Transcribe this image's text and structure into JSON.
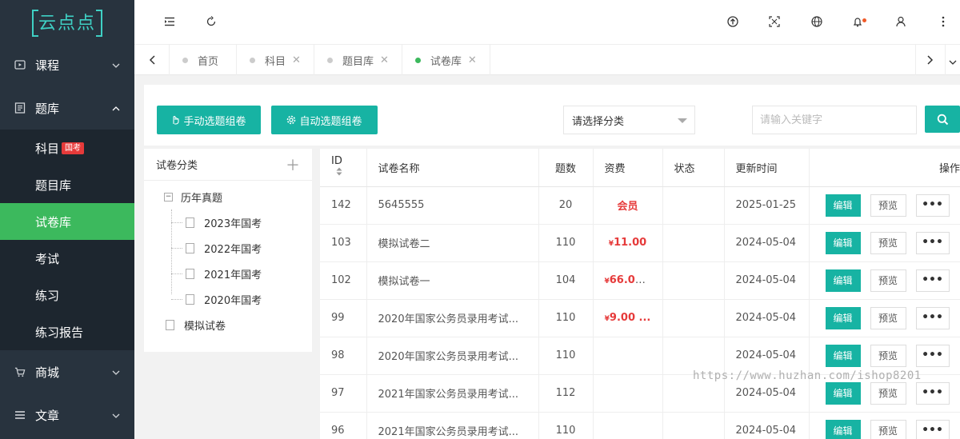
{
  "logo": {
    "text": "云点点"
  },
  "sidebar": {
    "groups": [
      {
        "label": "课程",
        "icon": "video-icon"
      },
      {
        "label": "题库",
        "icon": "book-icon"
      },
      {
        "label": "商城",
        "icon": "cart-icon"
      },
      {
        "label": "文章",
        "icon": "article-icon"
      }
    ],
    "items": [
      {
        "label": "科目",
        "badge": "国考"
      },
      {
        "label": "题目库"
      },
      {
        "label": "试卷库"
      },
      {
        "label": "考试"
      },
      {
        "label": "练习"
      },
      {
        "label": "练习报告"
      }
    ]
  },
  "tabs": [
    {
      "label": "首页"
    },
    {
      "label": "科目"
    },
    {
      "label": "题目库"
    },
    {
      "label": "试卷库"
    }
  ],
  "toolbar": {
    "manual_label": "手动选题组卷",
    "auto_label": "自动选题组卷",
    "select_value": "请选择分类",
    "search_placeholder": "请输入关键字"
  },
  "tree": {
    "title": "试卷分类",
    "root": "历年真题",
    "children": [
      "2023年国考",
      "2022年国考",
      "2021年国考",
      "2020年国考"
    ],
    "other": "模拟试卷"
  },
  "table": {
    "headers": {
      "id": "ID",
      "name": "试卷名称",
      "count": "题数",
      "fee": "资费",
      "status": "状态",
      "updated": "更新时间",
      "ops": "操作"
    },
    "edit_label": "编辑",
    "preview_label": "预览",
    "more_label": "•••",
    "rows": [
      {
        "id": "142",
        "name": "5645555",
        "count": "20",
        "fee": "会员",
        "updated": "2025-01-25"
      },
      {
        "id": "103",
        "name": "模拟试卷二",
        "count": "110",
        "fee": "¥11.00",
        "updated": "2024-05-04"
      },
      {
        "id": "102",
        "name": "模拟试卷一",
        "count": "104",
        "fee": "¥66.00...",
        "updated": "2024-05-04"
      },
      {
        "id": "99",
        "name": "2020年国家公务员录用考试...",
        "count": "110",
        "fee": "¥9.00 ...",
        "updated": "2024-05-04"
      },
      {
        "id": "98",
        "name": "2020年国家公务员录用考试...",
        "count": "110",
        "fee": "",
        "updated": "2024-05-04"
      },
      {
        "id": "97",
        "name": "2021年国家公务员录用考试...",
        "count": "112",
        "fee": "",
        "updated": "2024-05-04"
      },
      {
        "id": "96",
        "name": "2021年国家公务员录用考试...",
        "count": "110",
        "fee": "",
        "updated": "2024-05-04"
      }
    ]
  },
  "watermark": "https://www.huzhan.com/ishop8201",
  "colors": {
    "accent": "#17b3a3",
    "active": "#3cb95d",
    "sidebar": "#28333e",
    "price": "#e63a3a"
  }
}
